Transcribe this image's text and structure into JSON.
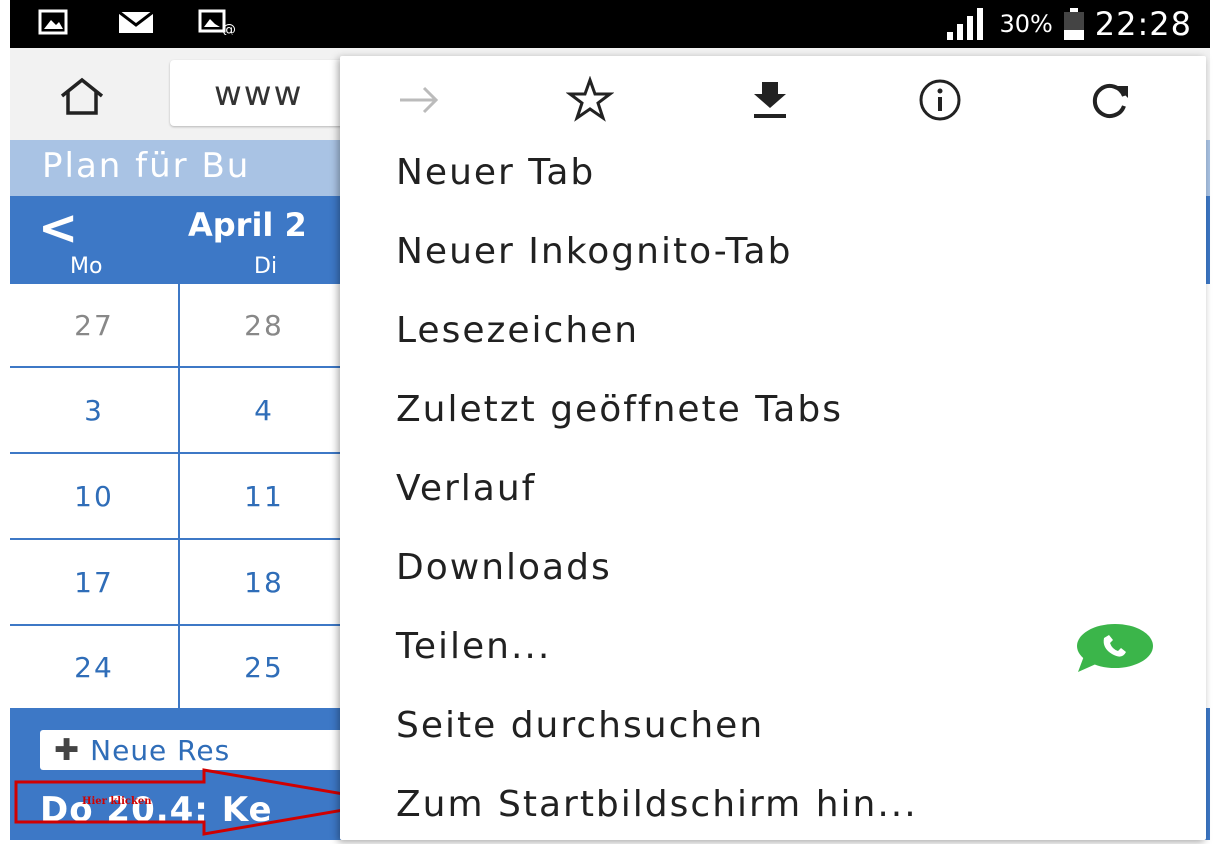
{
  "status_bar": {
    "battery": "30%",
    "time": "22:28",
    "icons": [
      "image-icon",
      "mail-icon",
      "mms-icon",
      "signal-icon",
      "battery-icon"
    ]
  },
  "toolbar": {
    "url_partial": "www"
  },
  "page": {
    "title_partial": "Plan für Bu",
    "month_partial": "April 2",
    "prev_label": "<",
    "days_of_week": [
      "Mo",
      "Di"
    ],
    "calendar_rows": [
      [
        "27",
        "28"
      ],
      [
        "3",
        "4"
      ],
      [
        "10",
        "11"
      ],
      [
        "17",
        "18"
      ],
      [
        "24",
        "25"
      ]
    ],
    "new_reservation_partial": "Neue Res",
    "event_partial": "Do 20.4: Ke",
    "annotation": "Hier klicken"
  },
  "menu": {
    "icons": [
      "forward-icon",
      "bookmark-star-icon",
      "download-icon",
      "info-icon",
      "reload-icon"
    ],
    "items": [
      "Neuer Tab",
      "Neuer Inkognito-Tab",
      "Lesezeichen",
      "Zuletzt geöffnete Tabs",
      "Verlauf",
      "Downloads",
      "Teilen...",
      "Seite durchsuchen",
      "Zum Startbildschirm hin..."
    ],
    "share_app_icon": "whatsapp-icon"
  },
  "colors": {
    "calendar_blue": "#3d78c6",
    "header_light_blue": "#a9c3e4",
    "annotation_red": "#d00000"
  }
}
